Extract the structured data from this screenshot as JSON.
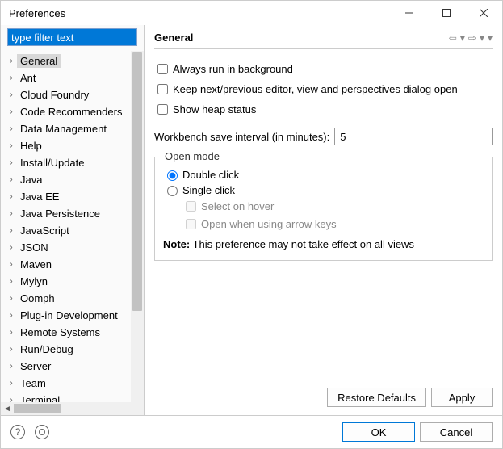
{
  "window": {
    "title": "Preferences"
  },
  "filter": {
    "placeholder": "type filter text",
    "value": "type filter text"
  },
  "tree": {
    "items": [
      {
        "label": "General",
        "selected": true
      },
      {
        "label": "Ant"
      },
      {
        "label": "Cloud Foundry"
      },
      {
        "label": "Code Recommenders"
      },
      {
        "label": "Data Management"
      },
      {
        "label": "Help"
      },
      {
        "label": "Install/Update"
      },
      {
        "label": "Java"
      },
      {
        "label": "Java EE"
      },
      {
        "label": "Java Persistence"
      },
      {
        "label": "JavaScript"
      },
      {
        "label": "JSON"
      },
      {
        "label": "Maven"
      },
      {
        "label": "Mylyn"
      },
      {
        "label": "Oomph"
      },
      {
        "label": "Plug-in Development"
      },
      {
        "label": "Remote Systems"
      },
      {
        "label": "Run/Debug"
      },
      {
        "label": "Server"
      },
      {
        "label": "Team"
      },
      {
        "label": "Terminal"
      }
    ]
  },
  "page": {
    "title": "General",
    "always_run_bg": "Always run in background",
    "keep_dialog": "Keep next/previous editor, view and perspectives dialog open",
    "show_heap": "Show heap status",
    "interval_label": "Workbench save interval (in minutes):",
    "interval_value": "5",
    "open_mode_title": "Open mode",
    "double_click": "Double click",
    "single_click": "Single click",
    "select_hover": "Select on hover",
    "open_arrow": "Open when using arrow keys",
    "note_label": "Note:",
    "note_text": "This preference may not take effect on all views",
    "restore_defaults": "Restore Defaults",
    "apply": "Apply"
  },
  "footer": {
    "ok": "OK",
    "cancel": "Cancel"
  }
}
